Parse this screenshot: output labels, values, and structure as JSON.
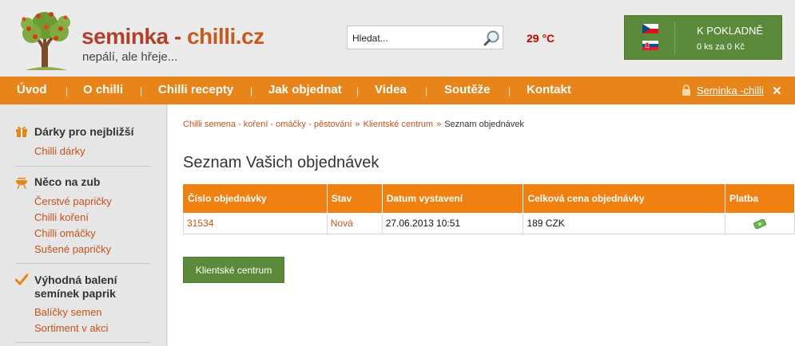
{
  "header": {
    "logo_name": "seminka - ",
    "logo_tld": "chilli.cz",
    "tagline": "nepálí, ale hřeje...",
    "search_placeholder": "Hledat...",
    "temperature": "29 °C",
    "cart_title": "K POKLADNĚ",
    "cart_summary": "0 ks za 0 Kč"
  },
  "nav": {
    "items": [
      "Úvod",
      "O chilli",
      "Chilli recepty",
      "Jak objednat",
      "Videa",
      "Soutěže",
      "Kontakt"
    ],
    "user_link": "Seminka -chilli",
    "close": "✕"
  },
  "sidebar": {
    "categories": [
      {
        "title": "Dárky pro nejbližší",
        "links": [
          "Chilli dárky"
        ]
      },
      {
        "title": "Něco na zub",
        "links": [
          "Čerstvé papričky",
          "Chilli koření",
          "Chilli omáčky",
          "Sušené papričky"
        ]
      },
      {
        "title_line1": "Výhodná balení",
        "title_line2": "semínek paprik",
        "links": [
          "Balíčky semen",
          "Sortiment v akci"
        ]
      }
    ]
  },
  "main": {
    "breadcrumb": [
      "Chilli semena - koření - omáčky - pěstování",
      "Klientské centrum",
      "Seznam objednávek"
    ],
    "breadcrumb_sep": "»",
    "title": "Seznam Vašich objednávek",
    "table": {
      "headers": [
        "Číslo objednávky",
        "Stav",
        "Datum vystavení",
        "Celková cena objednávky",
        "Platba"
      ],
      "rows": [
        {
          "number": "31534",
          "status": "Nová",
          "date": "27.06.2013 10:51",
          "price": "189 CZK"
        }
      ]
    },
    "button_label": "Klientské centrum"
  },
  "colors": {
    "nav_orange": "#e8851a",
    "table_header_orange": "#f08012",
    "cart_green": "#5a8a3a",
    "link_red": "#c4521a",
    "temperature_red": "#c40000"
  },
  "icons": {
    "search": "magnifier-icon",
    "lock": "lock-icon",
    "close": "close-icon",
    "gift": "gift-icon",
    "grill": "grill-icon",
    "check": "checkmark-icon",
    "payment": "banknote-icon",
    "flag_cz": "czech-flag-icon",
    "flag_sk": "slovak-flag-icon"
  }
}
